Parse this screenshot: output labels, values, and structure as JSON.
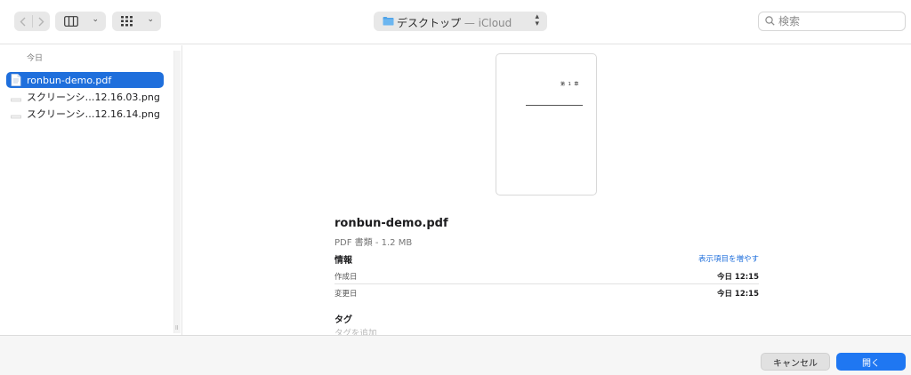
{
  "toolbar": {
    "back_icon": "chevron-left",
    "forward_icon": "chevron-right",
    "view_icon": "column-view",
    "group_icon": "grid-view",
    "location": {
      "folder": "デスクトップ",
      "separator": " — ",
      "service": "iCloud"
    },
    "search_placeholder": "検索"
  },
  "sidebar": {
    "section_label": "今日",
    "files": [
      {
        "name": "ronbun-demo.pdf",
        "selected": true,
        "kind": "pdf"
      },
      {
        "name": "スクリーンシ…12.16.03.png",
        "selected": false,
        "kind": "png"
      },
      {
        "name": "スクリーンシ…12.16.14.png",
        "selected": false,
        "kind": "png"
      }
    ]
  },
  "preview": {
    "thumbnail": {
      "chapter": "第 1 章"
    },
    "file_name": "ronbun-demo.pdf",
    "kind_size": "PDF 書類 - 1.2 MB",
    "info_heading": "情報",
    "show_more": "表示項目を増やす",
    "meta": [
      {
        "label": "作成日",
        "value": "今日 12:15"
      },
      {
        "label": "変更日",
        "value": "今日 12:15"
      }
    ],
    "tags_heading": "タグ",
    "tags_placeholder": "タグを追加"
  },
  "buttons": {
    "cancel": "キャンセル",
    "open": "開く"
  },
  "colors": {
    "accent": "#1f77f2",
    "selection": "#1f6fdc"
  }
}
